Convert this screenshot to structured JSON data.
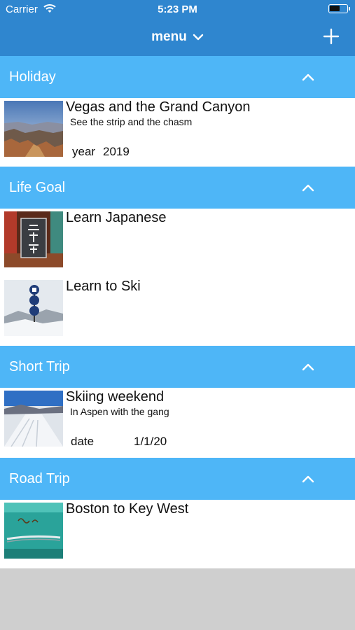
{
  "status_bar": {
    "carrier": "Carrier",
    "time": "5:23 PM"
  },
  "nav": {
    "title": "menu",
    "chevron_icon": "chevron-down-icon",
    "add_icon": "plus-icon"
  },
  "colors": {
    "nav_bg": "#2f86cf",
    "section_bg": "#4eb6f7",
    "row_bg": "#ffffff",
    "empty_bg": "#cfcfcf"
  },
  "sections": [
    {
      "title": "Holiday",
      "items": [
        {
          "title": "Vegas and the Grand Canyon",
          "subtitle": "See the strip and the chasm",
          "meta_label": "year",
          "meta_value": "2019",
          "thumb": "grand-canyon-photo"
        }
      ]
    },
    {
      "title": "Life Goal",
      "items": [
        {
          "title": "Learn Japanese",
          "thumb": "japanese-sign-photo"
        },
        {
          "title": "Learn to Ski",
          "thumb": "ski-slope-sign-photo"
        }
      ]
    },
    {
      "title": "Short Trip",
      "items": [
        {
          "title": "Skiing weekend",
          "subtitle": "In Aspen with the gang",
          "meta_label": "date",
          "meta_value": "1/1/20",
          "thumb": "snow-trail-photo"
        }
      ]
    },
    {
      "title": "Road Trip",
      "items": [
        {
          "title": "Boston to Key West",
          "thumb": "classic-car-photo"
        }
      ]
    }
  ]
}
